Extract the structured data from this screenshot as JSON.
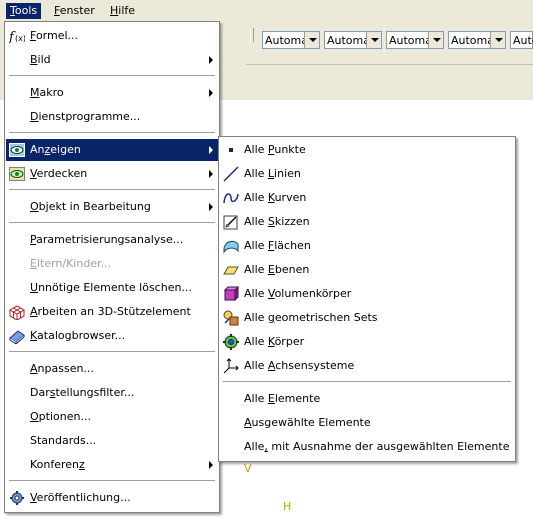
{
  "menubar": {
    "tools": {
      "pre": "",
      "u": "T",
      "post": "ools"
    },
    "fenster": {
      "pre": "",
      "u": "F",
      "post": "enster"
    },
    "hilfe": {
      "pre": "",
      "u": "H",
      "post": "ilfe"
    }
  },
  "toolbar": {
    "combos": [
      "Automa",
      "Automa",
      "Automa",
      "Automa",
      "Autom"
    ]
  },
  "tools_menu": {
    "formel": {
      "pre": "",
      "u": "F",
      "post": "ormel..."
    },
    "bild": {
      "pre": "",
      "u": "B",
      "post": "ild"
    },
    "makro": {
      "pre": "",
      "u": "M",
      "post": "akro"
    },
    "dienstprogramme": {
      "pre": "",
      "u": "D",
      "post": "ienstprogramme..."
    },
    "anzeigen": {
      "pre": "An",
      "u": "z",
      "post": "eigen"
    },
    "verdecken": {
      "pre": "",
      "u": "V",
      "post": "erdecken"
    },
    "objekt": {
      "pre": "",
      "u": "O",
      "post": "bjekt in Bearbeitung"
    },
    "parametrisierung": {
      "pre": "",
      "u": "P",
      "post": "arametrisierungsanalyse..."
    },
    "eltern": {
      "pre": "",
      "u": "E",
      "post": "ltern/Kinder..."
    },
    "unnoetige": {
      "pre": "",
      "u": "U",
      "post": "nnötige Elemente löschen..."
    },
    "arbeiten": {
      "pre": "",
      "u": "A",
      "post": "rbeiten an 3D-Stützelement"
    },
    "katalog": {
      "pre": "",
      "u": "K",
      "post": "atalogbrowser..."
    },
    "anpassen": {
      "pre": "",
      "u": "A",
      "post": "npassen..."
    },
    "darstellung": {
      "pre": "Dar",
      "u": "s",
      "post": "tellungsfilter..."
    },
    "optionen": {
      "pre": "",
      "u": "O",
      "post": "ptionen..."
    },
    "standards": {
      "pre": "",
      "u": "",
      "post": "Standards..."
    },
    "konferenz": {
      "pre": "Konferen",
      "u": "z",
      "post": ""
    },
    "veroeffentlichung": {
      "pre": "",
      "u": "V",
      "post": "eröffentlichung..."
    }
  },
  "anzeigen_submenu": {
    "punkte": {
      "pre": "Alle ",
      "u": "P",
      "post": "unkte"
    },
    "linien": {
      "pre": "Alle ",
      "u": "L",
      "post": "inien"
    },
    "kurven": {
      "pre": "Alle ",
      "u": "K",
      "post": "urven"
    },
    "skizzen": {
      "pre": "Alle ",
      "u": "S",
      "post": "kizzen"
    },
    "flaechen": {
      "pre": "Alle ",
      "u": "F",
      "post": "lächen"
    },
    "ebenen": {
      "pre": "Alle ",
      "u": "E",
      "post": "benen"
    },
    "volumen": {
      "pre": "Alle ",
      "u": "V",
      "post": "olumenkörper"
    },
    "sets": {
      "pre": "Alle ",
      "u": "g",
      "post": "eometrischen Sets"
    },
    "koerper": {
      "pre": "Alle ",
      "u": "K",
      "post": "örper"
    },
    "achsen": {
      "pre": "Alle ",
      "u": "A",
      "post": "chsensysteme"
    },
    "elemente": {
      "pre": "Alle ",
      "u": "E",
      "post": "lemente"
    },
    "ausgewaehlte": {
      "pre": "",
      "u": "A",
      "post": "usgewählte Elemente"
    },
    "ausnahme": {
      "pre": "Alle",
      "u": ",",
      "post": " mit Ausnahme der ausgewählten Elemente"
    }
  },
  "canvas": {
    "mark_v": "V",
    "mark_h": "H"
  },
  "colors": {
    "highlight": "#0a246a",
    "menu_bg": "#ffffff",
    "bar_bg": "#ece9d8",
    "disabled": "#a0a0a0"
  }
}
